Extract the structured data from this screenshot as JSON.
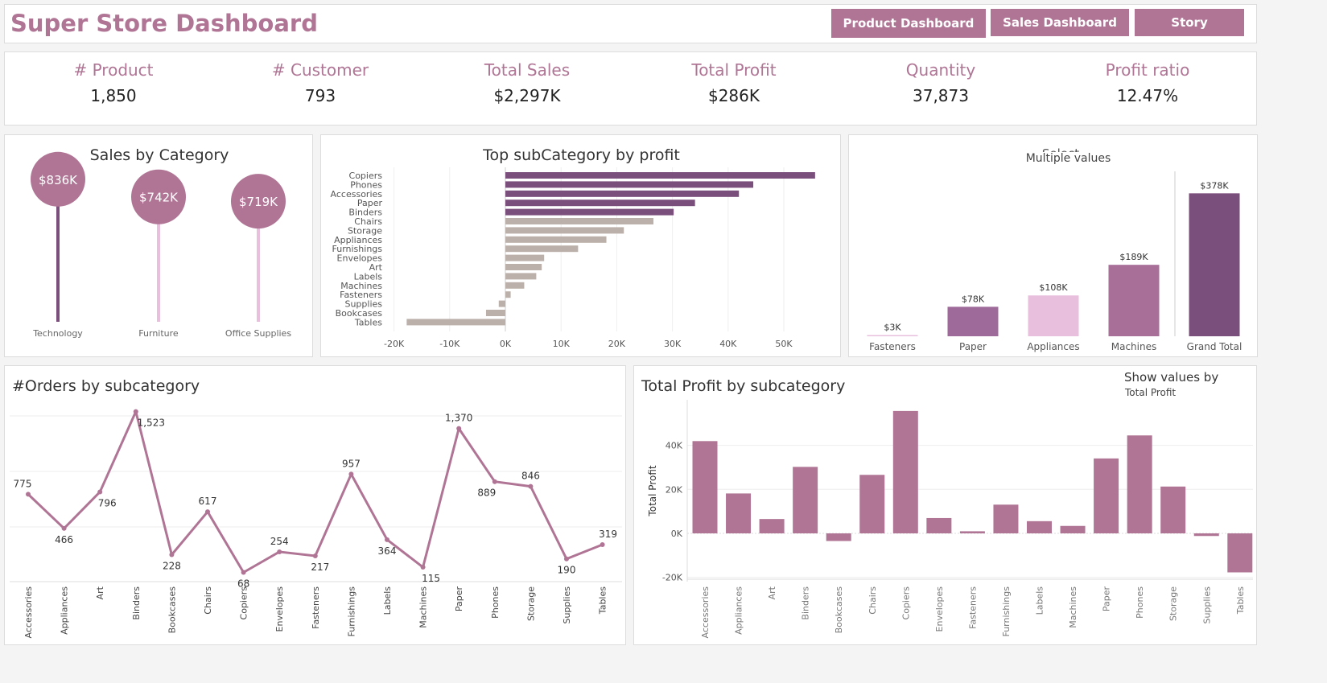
{
  "header": {
    "title": "Super Store Dashboard",
    "buttons": [
      "Product Dashboard",
      "Sales Dashboard",
      "Story"
    ]
  },
  "kpis": [
    {
      "label": "# Product",
      "value": "1,850"
    },
    {
      "label": "# Customer",
      "value": "793"
    },
    {
      "label": "Total Sales",
      "value": "$2,297K"
    },
    {
      "label": "Total Profit",
      "value": "$286K"
    },
    {
      "label": "Quantity",
      "value": "37,873"
    },
    {
      "label": "Profit ratio",
      "value": "12.47%"
    }
  ],
  "colors": {
    "accent": "#b07595",
    "dark": "#7b4f7b",
    "grey": "#bcb0aa",
    "light_pink": "#e8bfdd"
  },
  "chart_data": [
    {
      "id": "sales-by-category",
      "type": "lollipop",
      "title": "Sales by Category",
      "categories": [
        "Technology",
        "Furniture",
        "Office Supplies"
      ],
      "values": [
        836,
        742,
        719
      ],
      "labels": [
        "$836K",
        "$742K",
        "$719K"
      ]
    },
    {
      "id": "top-subcategory-profit",
      "type": "bar",
      "orientation": "horizontal",
      "title": "Top subCategory by profit",
      "categories": [
        "Copiers",
        "Phones",
        "Accessories",
        "Paper",
        "Binders",
        "Chairs",
        "Storage",
        "Appliances",
        "Furnishings",
        "Envelopes",
        "Art",
        "Labels",
        "Machines",
        "Fasteners",
        "Supplies",
        "Bookcases",
        "Tables"
      ],
      "values": [
        55618,
        44516,
        41937,
        34054,
        30222,
        26590,
        21279,
        18138,
        13059,
        6964,
        6528,
        5546,
        3385,
        950,
        -1189,
        -3473,
        -17725
      ],
      "highlight_top": 5,
      "xlim": [
        -20000,
        57000
      ],
      "xticks": [
        -20000,
        -10000,
        0,
        10000,
        20000,
        30000,
        40000,
        50000
      ],
      "xtick_labels": [
        "-20K",
        "-10K",
        "0K",
        "10K",
        "20K",
        "30K",
        "40K",
        "50K"
      ]
    },
    {
      "id": "selected-subcategory-sales",
      "type": "bar",
      "title_partial": "Select ...",
      "subtitle": "Multiple values",
      "categories": [
        "Fasteners",
        "Paper",
        "Appliances",
        "Machines",
        "Grand Total"
      ],
      "values": [
        3,
        78,
        108,
        189,
        378
      ],
      "labels": [
        "$3K",
        "$78K",
        "$108K",
        "$189K",
        "$378K"
      ],
      "colors": [
        "#e8bfdd",
        "#9e6a9a",
        "#e8bfdd",
        "#a86f99",
        "#7b4f7b"
      ],
      "ylim": [
        0,
        400
      ]
    },
    {
      "id": "orders-by-subcategory",
      "type": "line",
      "title": "#Orders by subcategory",
      "categories": [
        "Accessories",
        "Appliances",
        "Art",
        "Binders",
        "Bookcases",
        "Chairs",
        "Copiers",
        "Envelopes",
        "Fasteners",
        "Furnishings",
        "Labels",
        "Machines",
        "Paper",
        "Phones",
        "Storage",
        "Supplies",
        "Tables"
      ],
      "values": [
        775,
        466,
        796,
        1523,
        228,
        617,
        68,
        254,
        217,
        957,
        364,
        115,
        1370,
        889,
        846,
        190,
        319
      ],
      "labels": [
        "775",
        "466",
        "796",
        "1,523",
        "228",
        "617",
        "68",
        "254",
        "217",
        "957",
        "364",
        "115",
        "1,370",
        "889",
        "846",
        "190",
        "319"
      ],
      "ylim": [
        0,
        1523
      ]
    },
    {
      "id": "total-profit-by-subcategory",
      "type": "bar",
      "title": "Total Profit by subcategory",
      "ylabel": "Total Profit",
      "show_values_label": "Show values by",
      "show_values_value": "Total Profit",
      "categories": [
        "Accessories",
        "Appliances",
        "Art",
        "Binders",
        "Bookcases",
        "Chairs",
        "Copiers",
        "Envelopes",
        "Fasteners",
        "Furnishings",
        "Labels",
        "Machines",
        "Paper",
        "Phones",
        "Storage",
        "Supplies",
        "Tables"
      ],
      "values": [
        41937,
        18138,
        6528,
        30222,
        -3473,
        26590,
        55618,
        6964,
        950,
        13059,
        5546,
        3385,
        34054,
        44516,
        21279,
        -1189,
        -17725
      ],
      "ylim": [
        -20000,
        57000
      ],
      "yticks": [
        -20000,
        0,
        20000,
        40000
      ],
      "ytick_labels": [
        "-20K",
        "0K",
        "20K",
        "40K"
      ]
    }
  ]
}
